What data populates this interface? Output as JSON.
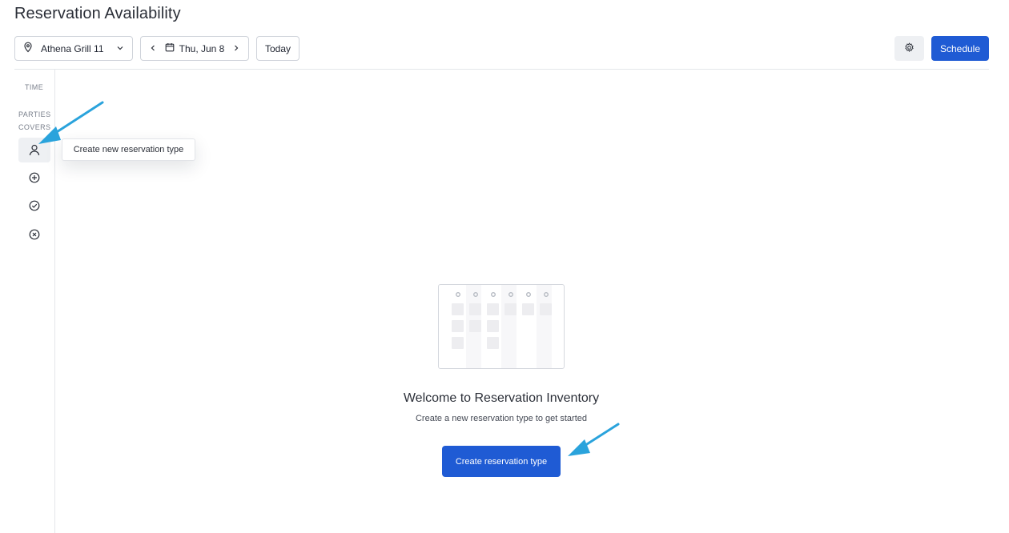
{
  "header": {
    "title": "Reservation Availability"
  },
  "toolbar": {
    "location": "Athena Grill 11",
    "date": "Thu, Jun 8",
    "today_label": "Today",
    "schedule_label": "Schedule"
  },
  "side_panel": {
    "time_label": "TIME",
    "parties_label": "PARTIES",
    "covers_label": "COVERS",
    "icons": [
      "person-icon",
      "plus-circle-icon",
      "check-circle-icon",
      "x-circle-icon"
    ]
  },
  "tooltip": {
    "text": "Create new reservation type"
  },
  "empty_state": {
    "title": "Welcome to Reservation Inventory",
    "subtitle": "Create a new reservation type to get started",
    "button_label": "Create reservation type"
  },
  "colors": {
    "primary": "#1f5bd4",
    "annotation_arrow": "#2aa3dc",
    "border": "#cfd3da"
  }
}
